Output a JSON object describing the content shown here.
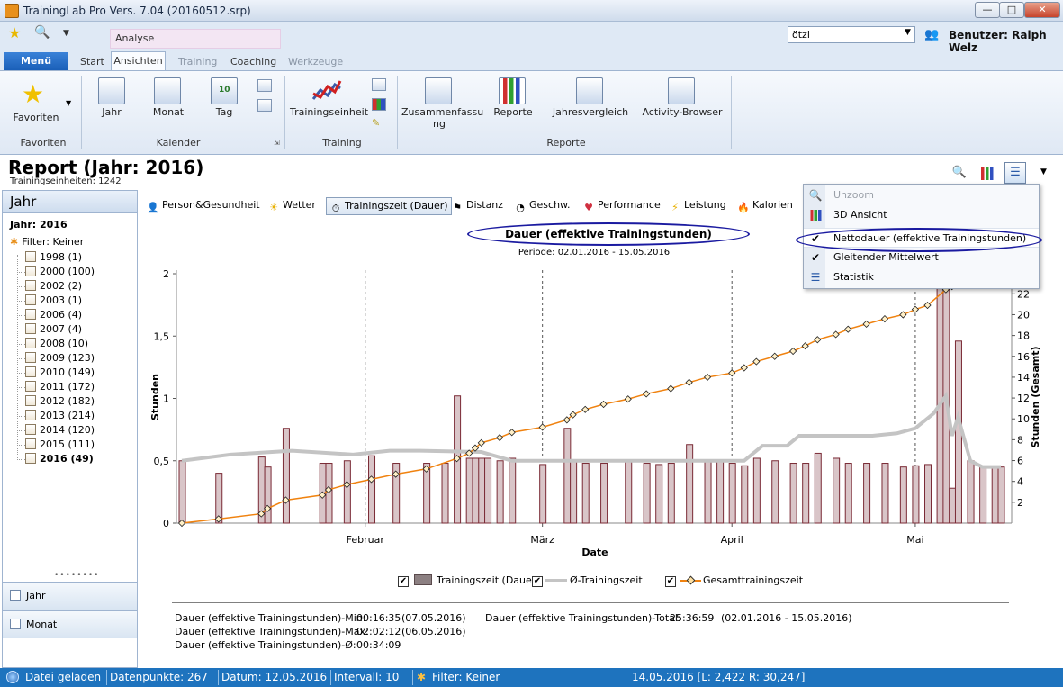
{
  "window": {
    "title": "TrainingLab Pro Vers. 7.04 (20160512.srp)",
    "minimize": "—",
    "maximize": "□",
    "close": "✕"
  },
  "quickaccess": {
    "context_tab": "Analyse",
    "user_value": "ötzi",
    "user_label": "Benutzer: Ralph Welz"
  },
  "ribbon_tabs": {
    "menu": "Menü",
    "start": "Start",
    "ansichten": "Ansichten",
    "training": "Training",
    "coaching": "Coaching",
    "werkzeuge": "Werkzeuge"
  },
  "ribbon": {
    "favoriten": {
      "button": "Favoriten",
      "group": "Favoriten"
    },
    "kalender": {
      "jahr": "Jahr",
      "monat": "Monat",
      "tag": "Tag",
      "tag_number": "10",
      "group": "Kalender"
    },
    "training": {
      "trainingseinheit": "Trainingseinheit",
      "group": "Training"
    },
    "reporte": {
      "zusammenfassung_1": "Zusammenfassu",
      "zusammenfassung_2": "ng",
      "reporte": "Reporte",
      "jahresvergleich": "Jahresvergleich",
      "activity_browser": "Activity-Browser",
      "group": "Reporte"
    }
  },
  "report": {
    "title": "Report (Jahr: 2016)",
    "subtitle": "Trainingseinheiten: 1242"
  },
  "left": {
    "header": "Jahr",
    "year_label": "Jahr: 2016",
    "filter": "Filter: Keiner",
    "years": [
      "1998 (1)",
      "2000 (100)",
      "2002 (2)",
      "2003 (1)",
      "2006 (4)",
      "2007 (4)",
      "2008 (10)",
      "2009 (123)",
      "2010 (149)",
      "2011 (172)",
      "2012 (182)",
      "2013 (214)",
      "2014 (120)",
      "2015 (111)",
      "2016 (49)"
    ],
    "splitter": "••••••••",
    "nav": [
      "Jahr",
      "Monat"
    ]
  },
  "report_tabs": [
    "Person&Gesundheit",
    "Wetter",
    "Trainingszeit (Dauer)",
    "Distanz",
    "Geschw.",
    "Performance",
    "Leistung",
    "Kalorien"
  ],
  "menu": {
    "items": [
      "Unzoom",
      "3D Ansicht",
      "Nettodauer (effektive Trainingstunden)",
      "Gleitender Mittelwert",
      "Statistik"
    ],
    "checked": [
      "",
      "",
      "✔",
      "✔",
      ""
    ]
  },
  "stats": {
    "min_label": "Dauer (effektive Trainingstunden)-Min:",
    "min_value": "00:16:35",
    "min_date": "(07.05.2016)",
    "max_label": "Dauer (effektive Trainingstunden)-Max:",
    "max_value": "02:02:12",
    "max_date": "(06.05.2016)",
    "avg_label": "Dauer (effektive Trainingstunden)-Ø:",
    "avg_value": "00:34:09",
    "total_label": "Dauer (effektive Trainingstunden)-Total:",
    "total_value": "25:36:59",
    "total_range": "(02.01.2016 - 15.05.2016)"
  },
  "statusbar": {
    "file": "Datei geladen",
    "points": "Datenpunkte: 267",
    "date": "Datum: 12.05.2016",
    "interval": "Intervall: 10",
    "filter": "Filter: Keiner",
    "cursor": "14.05.2016 [L: 2,422  R: 30,247]"
  },
  "colors": {
    "bar_fill": "#d9c5c8",
    "bar_stroke": "#7a2a35",
    "avg_line": "#c4c4c4",
    "total_line": "#f0820f",
    "status_bar": "#1e73be"
  },
  "chart_data": {
    "type": "bar",
    "title": "Dauer (effektive Trainingstunden)",
    "subtitle": "Periode: 02.01.2016 - 15.05.2016",
    "xlabel": "Date",
    "ylabel": "Stunden",
    "y2label": "Stunden (Gesamt)",
    "ylim": [
      0,
      2
    ],
    "y2lim": [
      0,
      26
    ],
    "yticks": [
      "0",
      "0,5",
      "1",
      "1,5",
      "2"
    ],
    "y2ticks": [
      "2",
      "4",
      "6",
      "8",
      "10",
      "12",
      "14",
      "16",
      "18",
      "20",
      "22"
    ],
    "xlim": [
      "2016-01-02",
      "2016-05-15"
    ],
    "month_ticks": [
      {
        "label": "Februar",
        "date": "2016-02-01"
      },
      {
        "label": "März",
        "date": "2016-03-01"
      },
      {
        "label": "April",
        "date": "2016-04-01"
      },
      {
        "label": "Mai",
        "date": "2016-05-01"
      }
    ],
    "grid": {
      "vertical_dashed_at_months": true
    },
    "legend_position": "bottom",
    "series": [
      {
        "name": "Trainingszeit (Dauer)",
        "type": "bar",
        "x": [
          "2016-01-02",
          "2016-01-08",
          "2016-01-15",
          "2016-01-16",
          "2016-01-19",
          "2016-01-25",
          "2016-01-26",
          "2016-01-29",
          "2016-02-02",
          "2016-02-06",
          "2016-02-11",
          "2016-02-14",
          "2016-02-16",
          "2016-02-18",
          "2016-02-19",
          "2016-02-20",
          "2016-02-21",
          "2016-02-23",
          "2016-02-25",
          "2016-03-01",
          "2016-03-05",
          "2016-03-06",
          "2016-03-08",
          "2016-03-11",
          "2016-03-15",
          "2016-03-18",
          "2016-03-20",
          "2016-03-22",
          "2016-03-25",
          "2016-03-28",
          "2016-03-30",
          "2016-04-01",
          "2016-04-03",
          "2016-04-05",
          "2016-04-08",
          "2016-04-11",
          "2016-04-13",
          "2016-04-15",
          "2016-04-18",
          "2016-04-20",
          "2016-04-23",
          "2016-04-26",
          "2016-04-29",
          "2016-05-01",
          "2016-05-03",
          "2016-05-05",
          "2016-05-06",
          "2016-05-07",
          "2016-05-08",
          "2016-05-10",
          "2016-05-12",
          "2016-05-14",
          "2016-05-15"
        ],
        "values": [
          0.5,
          0.4,
          0.53,
          0.45,
          0.76,
          0.48,
          0.48,
          0.5,
          0.54,
          0.48,
          0.48,
          0.48,
          1.02,
          0.52,
          0.52,
          0.52,
          0.52,
          0.5,
          0.52,
          0.47,
          0.76,
          0.5,
          0.48,
          0.48,
          0.5,
          0.48,
          0.47,
          0.48,
          0.63,
          0.5,
          0.5,
          0.48,
          0.46,
          0.52,
          0.5,
          0.48,
          0.48,
          0.56,
          0.52,
          0.48,
          0.48,
          0.48,
          0.45,
          0.46,
          0.47,
          1.9,
          2.04,
          0.28,
          1.46,
          0.5,
          0.45,
          0.45,
          0.45
        ]
      },
      {
        "name": "Ø-Trainingszeit",
        "type": "line",
        "x": [
          "2016-01-02",
          "2016-01-10",
          "2016-01-20",
          "2016-01-30",
          "2016-02-05",
          "2016-02-10",
          "2016-02-20",
          "2016-02-25",
          "2016-03-05",
          "2016-03-15",
          "2016-03-25",
          "2016-04-01",
          "2016-04-03",
          "2016-04-06",
          "2016-04-10",
          "2016-04-12",
          "2016-04-16",
          "2016-04-20",
          "2016-04-24",
          "2016-04-28",
          "2016-05-01",
          "2016-05-04",
          "2016-05-06",
          "2016-05-07",
          "2016-05-08",
          "2016-05-10",
          "2016-05-12",
          "2016-05-15"
        ],
        "values": [
          0.5,
          0.55,
          0.58,
          0.55,
          0.58,
          0.58,
          0.57,
          0.5,
          0.5,
          0.5,
          0.5,
          0.5,
          0.5,
          0.62,
          0.62,
          0.7,
          0.7,
          0.7,
          0.7,
          0.72,
          0.76,
          0.88,
          1.02,
          0.7,
          0.85,
          0.5,
          0.45,
          0.45
        ]
      },
      {
        "name": "Gesamttrainingszeit",
        "type": "line",
        "axis": "right",
        "x": [
          "2016-01-02",
          "2016-01-08",
          "2016-01-15",
          "2016-01-16",
          "2016-01-19",
          "2016-01-25",
          "2016-01-26",
          "2016-01-29",
          "2016-02-02",
          "2016-02-06",
          "2016-02-11",
          "2016-02-16",
          "2016-02-18",
          "2016-02-19",
          "2016-02-20",
          "2016-02-23",
          "2016-02-25",
          "2016-03-01",
          "2016-03-05",
          "2016-03-06",
          "2016-03-08",
          "2016-03-11",
          "2016-03-15",
          "2016-03-18",
          "2016-03-22",
          "2016-03-25",
          "2016-03-28",
          "2016-04-01",
          "2016-04-03",
          "2016-04-05",
          "2016-04-08",
          "2016-04-11",
          "2016-04-13",
          "2016-04-15",
          "2016-04-18",
          "2016-04-20",
          "2016-04-23",
          "2016-04-26",
          "2016-04-29",
          "2016-05-01",
          "2016-05-03",
          "2016-05-06",
          "2016-05-07",
          "2016-05-08",
          "2016-05-10"
        ],
        "values": [
          0,
          0.4,
          0.9,
          1.4,
          2.2,
          2.7,
          3.2,
          3.7,
          4.2,
          4.7,
          5.2,
          6.2,
          6.7,
          7.2,
          7.7,
          8.2,
          8.7,
          9.2,
          9.9,
          10.4,
          10.9,
          11.4,
          11.9,
          12.4,
          12.9,
          13.5,
          14.0,
          14.4,
          14.9,
          15.5,
          16.0,
          16.5,
          17.0,
          17.6,
          18.1,
          18.6,
          19.1,
          19.6,
          20.0,
          20.5,
          20.9,
          22.4,
          22.7,
          24.2,
          26.0
        ]
      }
    ]
  }
}
